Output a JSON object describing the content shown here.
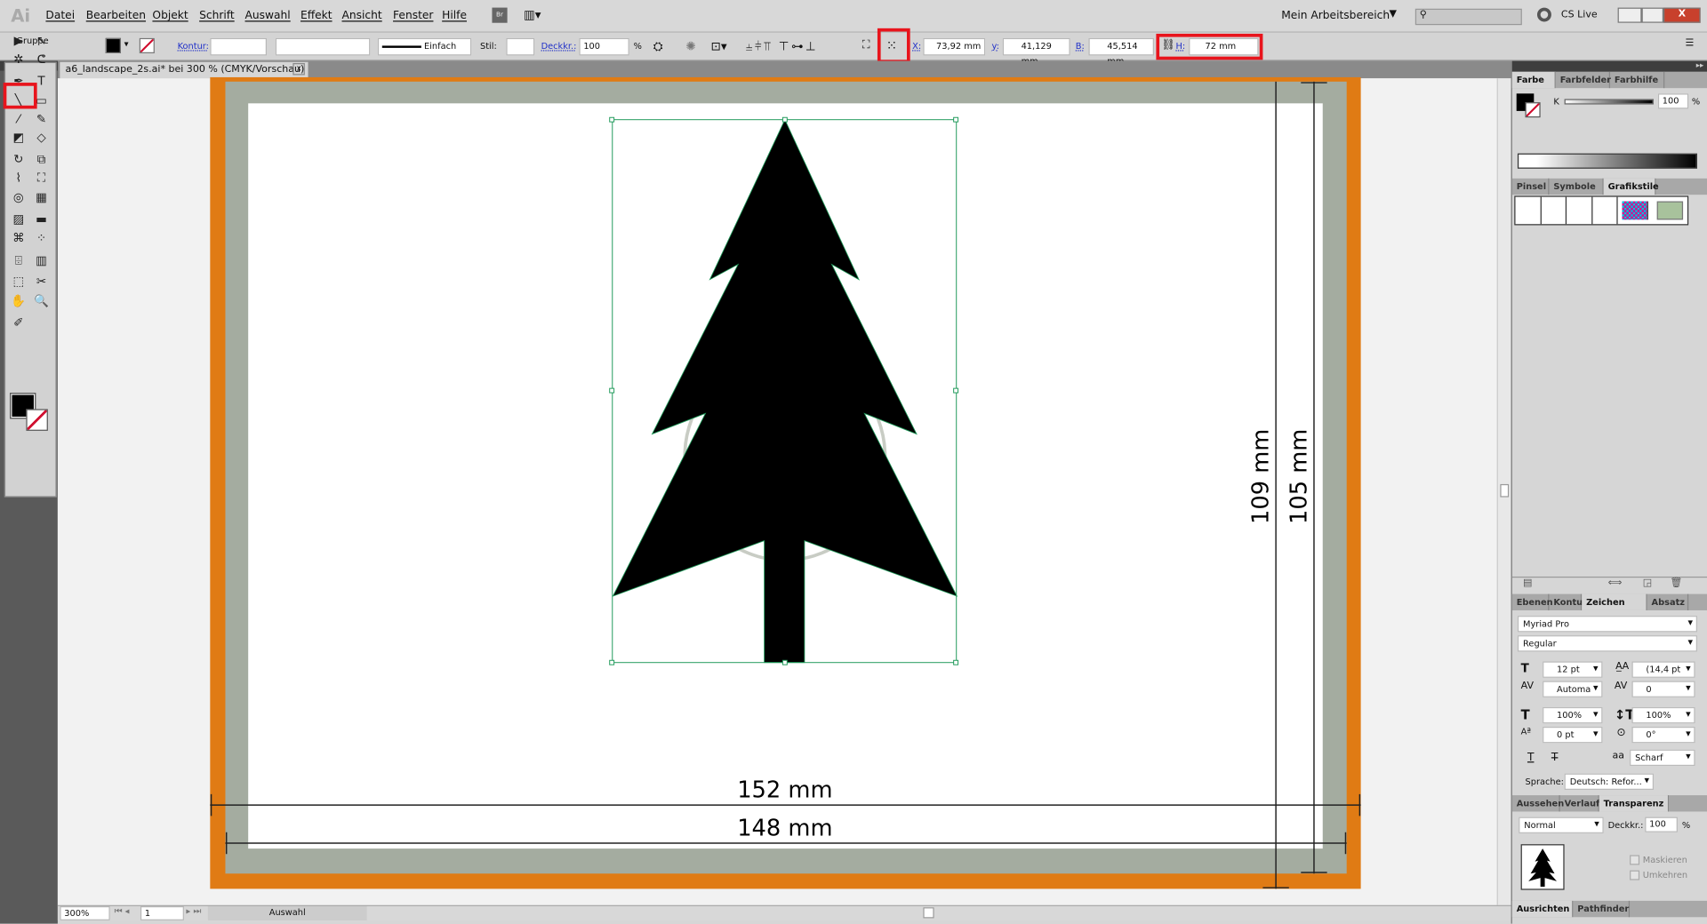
{
  "app": {
    "logo": "Ai",
    "menu": [
      "Datei",
      "Bearbeiten",
      "Objekt",
      "Schrift",
      "Auswahl",
      "Effekt",
      "Ansicht",
      "Fenster",
      "Hilfe"
    ],
    "bridge": "Br",
    "workspace": "Mein Arbeitsbereich",
    "cs_live": "CS Live",
    "window_close": "X"
  },
  "control": {
    "selection": "Gruppe",
    "kontur_label": "Kontur:",
    "stroke_style": "Einfach",
    "stil_label": "Stil:",
    "opacity_label": "Deckkr.:",
    "opacity": "100",
    "percent": "%",
    "x_label": "X:",
    "x": "73,92 mm",
    "y_label": "y:",
    "y": "41,129 mm",
    "b_label": "B:",
    "b": "45,514 mm",
    "h_label": "H:",
    "h": "72 mm"
  },
  "document": {
    "tab": "a6_landscape_2s.ai* bei 300 % (CMYK/Vorschau)",
    "close": "x"
  },
  "canvas": {
    "dim_outer_w": "152 mm",
    "dim_inner_w": "148 mm",
    "dim_outer_h": "109 mm",
    "dim_inner_h": "105 mm",
    "colors": {
      "bleed": "#e07b14",
      "frame": "#a4aca0",
      "selection": "#1f9a5a"
    }
  },
  "status": {
    "zoom": "300%",
    "page": "1",
    "mode": "Auswahl"
  },
  "panels": {
    "color": {
      "tabs": [
        "Farbe",
        "Farbfelder",
        "Farbhilfe"
      ],
      "k_label": "K",
      "k": "100",
      "percent": "%"
    },
    "styles": {
      "tabs": [
        "Pinsel",
        "Symbole",
        "Grafikstile"
      ]
    },
    "character": {
      "tabs": [
        "Ebenen",
        "Kontur",
        "Zeichen",
        "Absatz"
      ],
      "font": "Myriad Pro",
      "style": "Regular",
      "size": "12 pt",
      "leading": "(14,4 pt",
      "kerning": "Automa",
      "tracking": "0",
      "hscale": "100%",
      "vscale": "100%",
      "baseline": "0 pt",
      "rotation": "0°",
      "antialias": "Scharf",
      "language_label": "Sprache:",
      "language": "Deutsch: Refor..."
    },
    "transparency": {
      "tabs": [
        "Aussehen",
        "Verlauf",
        "Transparenz"
      ],
      "mode": "Normal",
      "opacity_label": "Deckkr.:",
      "opacity": "100",
      "percent": "%",
      "mask": "Maskieren",
      "invert": "Umkehren"
    },
    "bottom": {
      "tabs": [
        "Ausrichten",
        "Pathfinder"
      ]
    }
  },
  "tools": [
    "▶",
    "↖",
    "✲",
    "ᕦ",
    "✒",
    "T",
    "╲",
    "▭",
    "⁄",
    "✎",
    "◩",
    "◇",
    "↻",
    "⧉",
    "⌇",
    "⛶",
    "◎",
    "▦",
    "▨",
    "▬",
    "⌘",
    "⁘",
    "⌹",
    "▥",
    "⬚",
    "✂",
    "✋",
    "🔍",
    "✐"
  ]
}
